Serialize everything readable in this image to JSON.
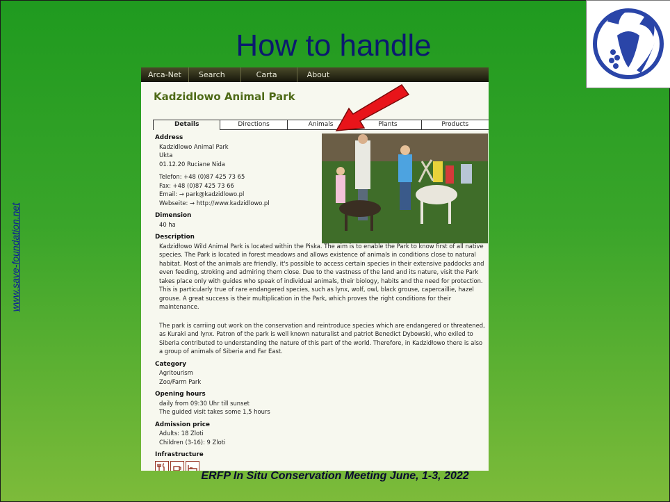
{
  "slide": {
    "title": "How to handle",
    "side_link": "www.save-foundation.net",
    "footer": "ERFP In Situ Conservation Meeting June, 1-3, 2022"
  },
  "web": {
    "nav": [
      "Arca-Net",
      "Search",
      "Carta",
      "About"
    ],
    "park_title": "Kadzidlowo Animal Park",
    "tabs": [
      "Details",
      "Directions",
      "Animals",
      "Plants",
      "Products"
    ],
    "active_tab": "Details",
    "address": {
      "heading": "Address",
      "lines": [
        "Kadzidlowo Animal Park",
        "Ukta",
        "01.12.20 Ruciane Nida"
      ],
      "contact": [
        "Telefon: +48 (0)87 425 73 65",
        "Fax: +48 (0)87 425 73 66",
        "Email: → park@kadzidlowo.pl",
        "Webseite: → http://www.kadzidlowo.pl"
      ]
    },
    "dimension": {
      "heading": "Dimension",
      "value": "40 ha"
    },
    "description": {
      "heading": "Description",
      "p1": "Kadzidłowo Wild Animal Park is located within the Piska. The aim is to enable the Park to know first of all native species. The Park is located in forest meadows and allows existence of animals in conditions close to natural habitat. Most of the animals are friendly, it's possible to access certain species in their extensive paddocks and even feeding, stroking and admiring them close. Due to the vastness of the land and its nature, visit the Park takes place only with guides who speak of individual animals, their biology, habits and the need for protection. This is particularly true of rare endangered species, such as lynx, wolf, owl, black grouse, capercaillie, hazel grouse. A great success is their multiplication in the Park, which proves the right conditions for their maintenance.",
      "p2": "The park is carriing out work on the conservation and reintroduce species which are endangered or threatened, as Kuraki and lynx. Patron of the park is well known naturalist and patriot Benedict Dybowski, who exiled to Siberia contributed to understanding the nature of this part of the world. Therefore, in Kadzidłowo there is also a group of animals of Siberia and Far East."
    },
    "category": {
      "heading": "Category",
      "lines": [
        "Agritourism",
        "Zoo/Farm Park"
      ]
    },
    "opening": {
      "heading": "Opening hours",
      "lines": [
        "daily from 09:30 Uhr till sunset",
        "The guided visit takes some 1,5 hours"
      ]
    },
    "admission": {
      "heading": "Admission price",
      "lines": [
        "Adults: 18 Zloti",
        "Children (3-16): 9 Zloti"
      ]
    },
    "infrastructure": {
      "heading": "Infrastructure",
      "icons": [
        "restaurant-icon",
        "coffee-icon",
        "bed-icon"
      ]
    }
  },
  "colors": {
    "title": "#0b1a6e",
    "park_title": "#4e6a17",
    "arrow": "#e8141a"
  }
}
